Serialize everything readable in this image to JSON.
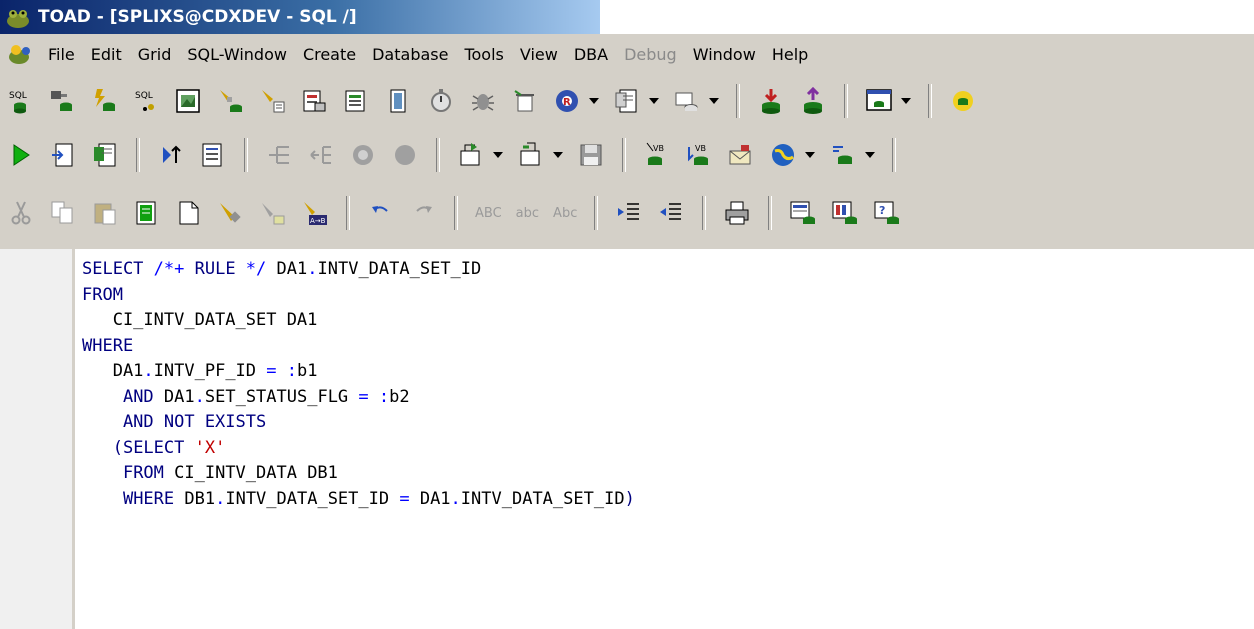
{
  "window": {
    "title": "TOAD - [SPLIXS@CDXDEV - SQL /]"
  },
  "menu": [
    "File",
    "Edit",
    "Grid",
    "SQL-Window",
    "Create",
    "Database",
    "Tools",
    "View",
    "DBA",
    "Debug",
    "Window",
    "Help"
  ],
  "toolbar3": {
    "abc_upper": "ABC",
    "abc_lower": "abc",
    "abc_title": "Abc"
  },
  "editor": {
    "lines": [
      "SELECT /*+ RULE */ DA1.INTV_DATA_SET_ID",
      "FROM",
      "   CI_INTV_DATA_SET DA1",
      "WHERE",
      "   DA1.INTV_PF_ID = :b1",
      "    AND DA1.SET_STATUS_FLG = :b2",
      "    AND NOT EXISTS",
      "   (SELECT 'X'",
      "    FROM CI_INTV_DATA DB1",
      "    WHERE DB1.INTV_DATA_SET_ID = DA1.INTV_DATA_SET_ID)"
    ]
  }
}
